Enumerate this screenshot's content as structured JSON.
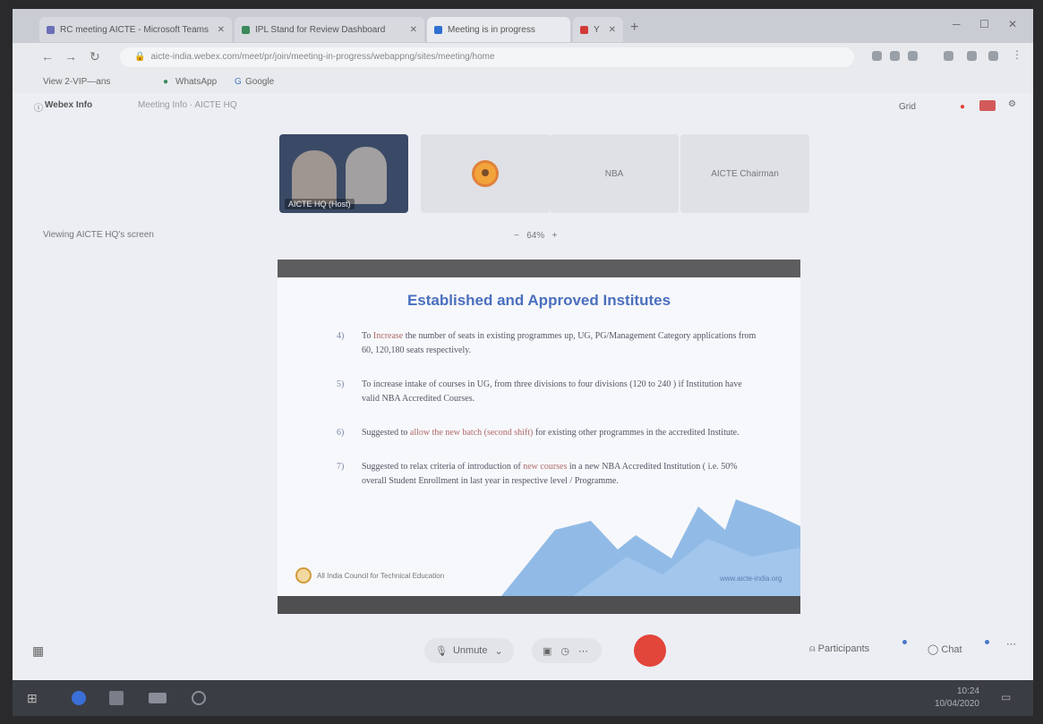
{
  "browser": {
    "tabs": [
      {
        "label": "RC meeting AICTE - Microsoft Teams",
        "color": "#6a6fb8"
      },
      {
        "label": "IPL Stand for Review Dashboard",
        "color": "#3b8a5b"
      },
      {
        "label": "Meeting is in progress",
        "color": "#2f6fd1"
      },
      {
        "label": "Y",
        "color": "#d23a3a"
      }
    ],
    "new_tab": "+",
    "url": "aicte-india.webex.com/meet/pr/join/meeting-in-progress/webappng/sites/meeting/home",
    "bookmarks": [
      "View 2-VIP—ans",
      "WhatsApp",
      "Google"
    ]
  },
  "meeting": {
    "title": "Webex Info",
    "subtitle": "Meeting Info · AICTE HQ",
    "view_label": "Grid",
    "participants": [
      {
        "name": "AICTE HQ (Host)",
        "type": "video"
      },
      {
        "name": "",
        "type": "avatar"
      },
      {
        "name": "NBA",
        "type": "name"
      },
      {
        "name": "AICTE Chairman",
        "type": "name"
      }
    ],
    "viewing_text": "Viewing AICTE HQ's screen",
    "zoom": "64%",
    "zoom_minus": "−",
    "zoom_plus": "+"
  },
  "slide": {
    "title": "Established and Approved Institutes",
    "points": [
      {
        "num": "4)",
        "text_before": "To ",
        "emphasis": "Increase",
        "text_after": " the number of seats in existing programmes up, UG, PG/Management Category applications from 60, 120,180 seats respectively."
      },
      {
        "num": "5)",
        "text_before": "To increase intake of courses in UG, from three divisions to four divisions (120 to 240 ) if Institution have valid NBA Accredited Courses.",
        "emphasis": "",
        "text_after": ""
      },
      {
        "num": "6)",
        "text_before": "Suggested to ",
        "emphasis": "allow the new batch (second shift)",
        "text_after": " for existing other programmes in the accredited Institute."
      },
      {
        "num": "7)",
        "text_before": "Suggested to relax criteria of introduction of ",
        "emphasis": "new courses",
        "text_after": " in a new NBA Accredited Institution ( i.e. 50% overall Student Enrollment in last year in respective level / Programme."
      }
    ],
    "logo_text": "All India Council for Technical Education",
    "footer_text": "www.aicte-india.org"
  },
  "controls": {
    "unmute_label": "Unmute",
    "participants_label": "Participants",
    "chat_label": "Chat"
  },
  "taskbar": {
    "time": "10:24",
    "date": "10/04/2020"
  },
  "colors": {
    "accent": "#4a6fbe",
    "end_call": "#e2453a",
    "chart_fill": "#7fb0e2"
  }
}
